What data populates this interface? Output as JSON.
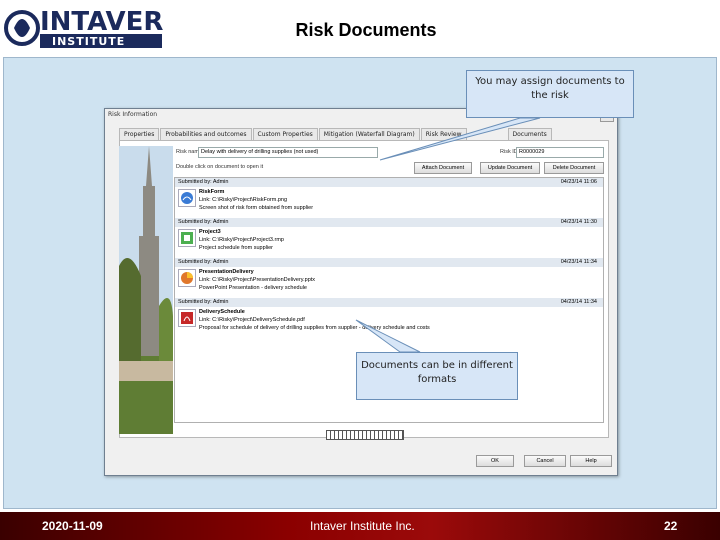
{
  "slide": {
    "title": "Risk Documents"
  },
  "logo": {
    "word": "INTAVER",
    "sub": "INSTITUTE"
  },
  "footer": {
    "date": "2020-11-09",
    "org": "Intaver Institute Inc.",
    "page": "22"
  },
  "dialog": {
    "title": "Risk Information",
    "tabs": [
      "Properties",
      "Probabilities and outcomes",
      "Custom Properties",
      "Mitigation (Waterfall Diagram)",
      "Risk Review",
      "Documents"
    ],
    "active_tab": "Documents",
    "risk_name_label": "Risk name",
    "risk_name_value": "Delay with delivery of drilling supplies (not used)",
    "risk_id_label": "Risk ID",
    "risk_id_value": "R0000029",
    "instruction": "Double click on document to open it",
    "buttons": {
      "attach": "Attach Document",
      "delete_doc": "Delete Document",
      "update": "Update Document",
      "ok": "OK",
      "cancel": "Cancel",
      "help": "Help"
    },
    "documents": [
      {
        "submitted": "Submitted by: Admin",
        "date": "04/23/14 11:06",
        "name": "RiskForm",
        "link": "Link: C:\\Risky\\Project\\RiskForm.png",
        "desc": "Screen shot of risk form obtained from supplier",
        "icon": "image-file-icon"
      },
      {
        "submitted": "Submitted by: Admin",
        "date": "04/23/14 11:30",
        "name": "Project3",
        "link": "Link: C:\\Risky\\Project\\Project3.rmp",
        "desc": "Project schedule from supplier",
        "icon": "project-file-icon"
      },
      {
        "submitted": "Submitted by: Admin",
        "date": "04/23/14 11:34",
        "name": "PresentationDelivery",
        "link": "Link: C:\\Risky\\Project\\PresentationDelivery.pptx",
        "desc": "PowerPoint Presentation - delivery schedule",
        "icon": "powerpoint-file-icon"
      },
      {
        "submitted": "Submitted by: Admin",
        "date": "04/23/14 11:34",
        "name": "DeliverySchedule",
        "link": "Link: C:\\Risky\\Project\\DeliverySchedule.pdf",
        "desc": "Proposal for schedule of delivery of drilling supplies from supplier - delivery schedule and costs",
        "icon": "pdf-file-icon"
      }
    ]
  },
  "callouts": {
    "assign": "You may assign documents to the risk",
    "formats": "Documents can be in different formats"
  },
  "colors": {
    "footer": "#8b0000",
    "panel": "#cfe3f1",
    "callout": "#d7e6f7",
    "logo": "#1b2a5c"
  }
}
